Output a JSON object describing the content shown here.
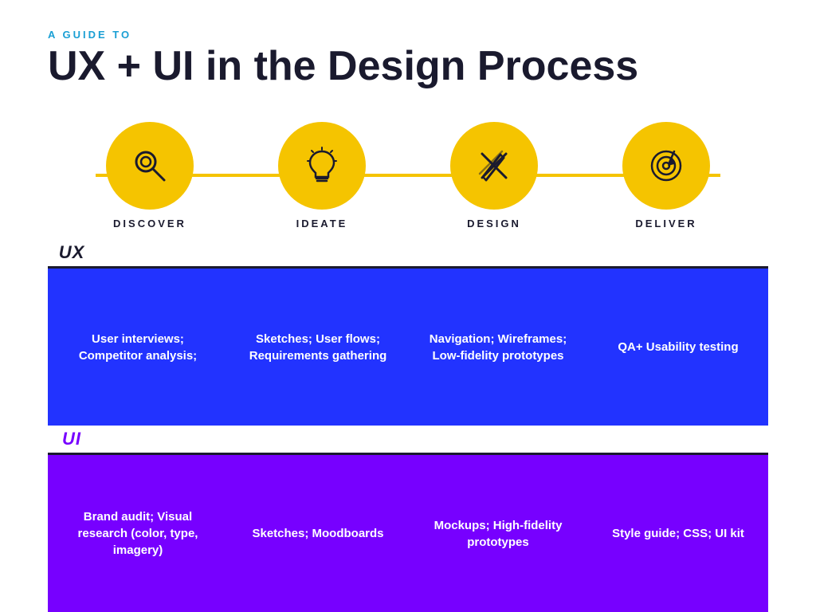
{
  "header": {
    "subtitle": "A GUIDE TO",
    "title": "UX + UI in the Design Process"
  },
  "stages": [
    {
      "id": "discover",
      "label": "DISCOVER",
      "icon": "search"
    },
    {
      "id": "ideate",
      "label": "IDEATE",
      "icon": "bulb"
    },
    {
      "id": "design",
      "label": "DESIGN",
      "icon": "tools"
    },
    {
      "id": "deliver",
      "label": "DELIVER",
      "icon": "target"
    }
  ],
  "ux": {
    "label": "UX",
    "cells": [
      "User interviews; Competitor analysis;",
      "Sketches; User flows; Requirements gathering",
      "Navigation; Wireframes; Low-fidelity prototypes",
      "QA+ Usability testing"
    ]
  },
  "ui": {
    "label": "UI",
    "cells": [
      "Brand audit; Visual research (color, type, imagery)",
      "Sketches; Moodboards",
      "Mockups; High-fidelity prototypes",
      "Style guide; CSS; UI kit"
    ]
  }
}
